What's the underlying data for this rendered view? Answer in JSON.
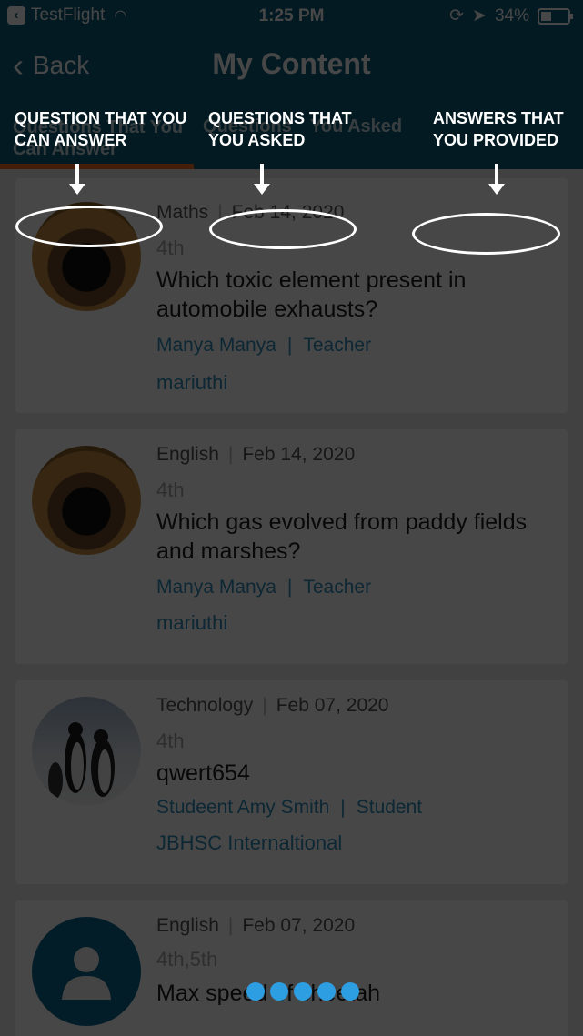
{
  "status_bar": {
    "carrier": "TestFlight",
    "time": "1:25 PM",
    "battery": "34%"
  },
  "header": {
    "back_label": "Back",
    "title": "My Content"
  },
  "tabs": [
    {
      "label": "Questions That You Can Answer"
    },
    {
      "label": "Questions"
    },
    {
      "label": "You Asked"
    }
  ],
  "tooltips": [
    {
      "text": "QUESTION THAT YOU CAN ANSWER"
    },
    {
      "text": "QUESTIONS THAT YOU ASKED"
    },
    {
      "text": "ANSWERS THAT YOU PROVIDED"
    }
  ],
  "cards": [
    {
      "subject": "Maths",
      "date": "Feb 14, 2020",
      "grade": "4th",
      "question": "Which toxic element present in automobile exhausts?",
      "author": "Manya Manya",
      "role": "Teacher",
      "school": "mariuthi"
    },
    {
      "subject": "English",
      "date": "Feb 14, 2020",
      "grade": "4th",
      "question": "Which gas evolved from  paddy fields and marshes?",
      "author": "Manya Manya",
      "role": "Teacher",
      "school": "mariuthi"
    },
    {
      "subject": "Technology",
      "date": "Feb 07, 2020",
      "grade": "4th",
      "question": "qwert654",
      "author": "Studeent Amy Smith",
      "role": "Student",
      "school": "JBHSC Internaltional"
    },
    {
      "subject": "English",
      "date": "Feb 07, 2020",
      "grade": "4th,5th",
      "question": "Max speed of cheetah"
    }
  ],
  "pager": {
    "count": 5,
    "color": "#2e9ee3"
  },
  "colors": {
    "brand": "#0d5d7c",
    "accent": "#f26b1d",
    "link": "#2f8ebb"
  }
}
